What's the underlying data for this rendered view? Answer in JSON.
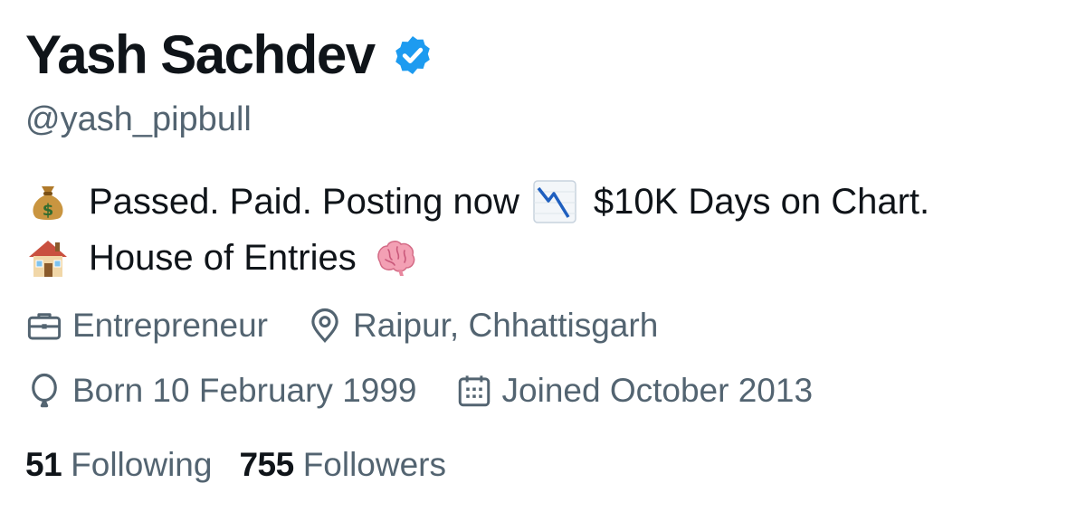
{
  "profile": {
    "display_name": "Yash Sachdev",
    "verified_icon": "verified-badge-icon",
    "handle": "@yash_pipbull",
    "bio": {
      "line1_text1": "Passed. Paid. Posting now",
      "line1_text2": "$10K Days on Chart.",
      "line2_text": "House of Entries",
      "emojis": [
        "money-bag-icon",
        "chart-decreasing-icon",
        "house-icon",
        "brain-icon"
      ]
    },
    "meta": {
      "profession": {
        "icon": "briefcase-icon",
        "text": "Entrepreneur"
      },
      "location": {
        "icon": "location-pin-icon",
        "text": "Raipur, Chhattisgarh"
      },
      "birthday": {
        "icon": "balloon-icon",
        "text": "Born 10 February 1999"
      },
      "joined": {
        "icon": "calendar-icon",
        "text": "Joined October 2013"
      }
    },
    "stats": {
      "following_count": "51",
      "following_label": "Following",
      "followers_count": "755",
      "followers_label": "Followers"
    }
  },
  "colors": {
    "primary_text": "#0f1419",
    "secondary_text": "#536471",
    "verified_blue": "#1d9bf0"
  }
}
